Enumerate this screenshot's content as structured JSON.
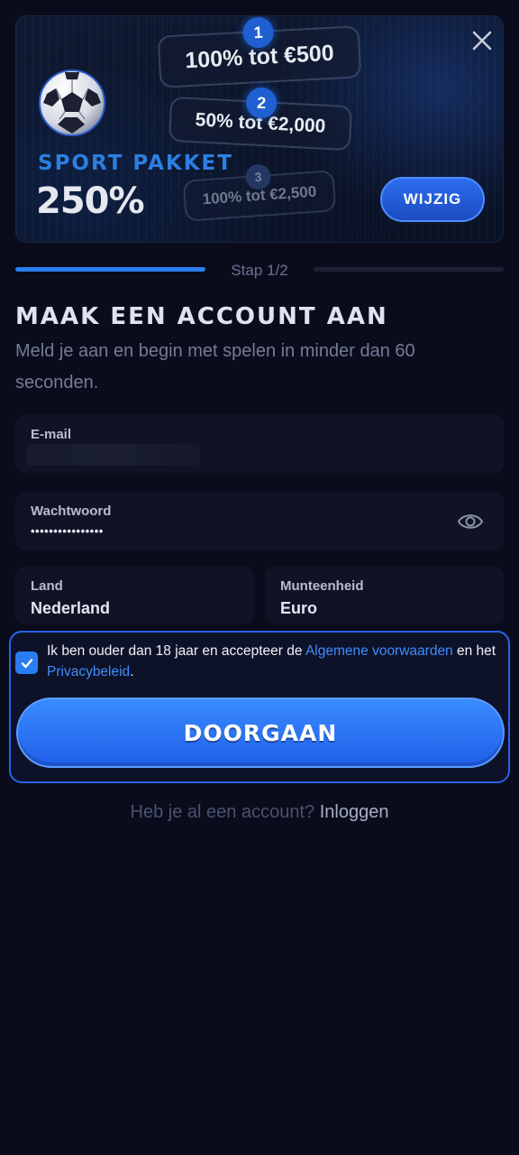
{
  "banner": {
    "package_label": "SPORT PAKKET",
    "package_value": "250%",
    "tiers": [
      {
        "num": "1",
        "text": "100% tot €500"
      },
      {
        "num": "2",
        "text": "50% tot €2,000"
      },
      {
        "num": "3",
        "text": "100% tot €2,500"
      }
    ],
    "change_label": "WIJZIG"
  },
  "steps": {
    "label": "Stap 1/2",
    "progress": 0.5
  },
  "form": {
    "title": "MAAK EEN ACCOUNT AAN",
    "subtitle": "Meld je aan en begin met spelen in minder dan 60 seconden.",
    "email": {
      "label": "E-mail",
      "value": ""
    },
    "password": {
      "label": "Wachtwoord",
      "value": "••••••••••••••••"
    },
    "country": {
      "label": "Land",
      "value": "Nederland"
    },
    "currency": {
      "label": "Munteenheid",
      "value": "Euro"
    }
  },
  "terms": {
    "checked": true,
    "text_before": "Ik ben ouder dan 18 jaar en accepteer de ",
    "terms_link": "Algemene voorwaarden",
    "text_middle": " en het ",
    "privacy_link": "Privacybeleid",
    "text_after": "."
  },
  "continue_label": "DOORGAAN",
  "login": {
    "prompt": "Heb je al een account?",
    "link": "Inloggen"
  },
  "colors": {
    "accent": "#2a7df0",
    "background": "#0a0c1c",
    "link": "#3f8cff"
  },
  "icons": [
    "close-icon",
    "soccer-ball-icon",
    "eye-icon",
    "check-icon"
  ]
}
